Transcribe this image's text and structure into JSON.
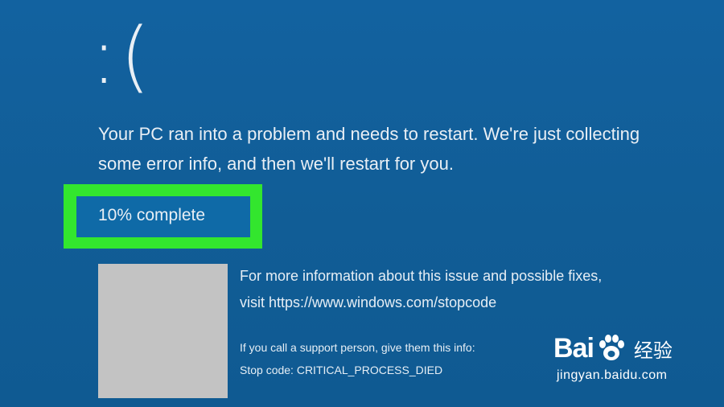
{
  "screen": {
    "sad_face": ":(",
    "message": "Your PC ran into a problem and needs to restart. We're just collecting some error info, and then we'll restart for you.",
    "progress_text": "10% complete",
    "progress_percent": 10,
    "highlight_color": "#33e62e",
    "background_color": "#125f95",
    "qr_placeholder_color": "#c3c3c3",
    "info_line": "For more information about this issue and possible fixes, visit https://www.windows.com/stopcode",
    "support_line": "If you call a support person, give them this info:",
    "stop_code": "Stop code: CRITICAL_PROCESS_DIED"
  },
  "watermark": {
    "brand_left": "Bai",
    "paw_icon": "paw-icon",
    "brand_right": "经验",
    "url": "jingyan.baidu.com"
  }
}
